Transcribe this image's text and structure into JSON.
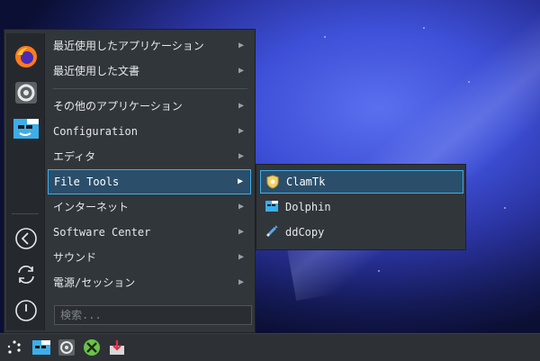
{
  "menu": {
    "items": [
      {
        "label": "最近使用したアプリケーション"
      },
      {
        "label": "最近使用した文書"
      },
      {
        "label": "その他のアプリケーション"
      },
      {
        "label": "Configuration"
      },
      {
        "label": "エディタ"
      },
      {
        "label": "File Tools"
      },
      {
        "label": "インターネット"
      },
      {
        "label": "Software Center"
      },
      {
        "label": "サウンド"
      },
      {
        "label": "電源/セッション"
      }
    ],
    "search_placeholder": "検索..."
  },
  "favorites": [
    "firefox-icon",
    "system-settings-icon",
    "file-manager-icon"
  ],
  "session_buttons": [
    "back-icon",
    "refresh-icon",
    "power-icon"
  ],
  "submenu": {
    "items": [
      {
        "label": "ClamTk",
        "icon": "clamtk-shield-icon"
      },
      {
        "label": "Dolphin",
        "icon": "dolphin-icon"
      },
      {
        "label": "ddCopy",
        "icon": "ddcopy-icon"
      }
    ]
  },
  "taskbar": [
    "app-menu-icon",
    "file-manager-icon",
    "system-settings-icon",
    "games-icon",
    "installer-icon"
  ],
  "colors": {
    "accent": "#3daee9",
    "menu_bg": "#31363b",
    "selected_bg": "#2b4e6a"
  }
}
